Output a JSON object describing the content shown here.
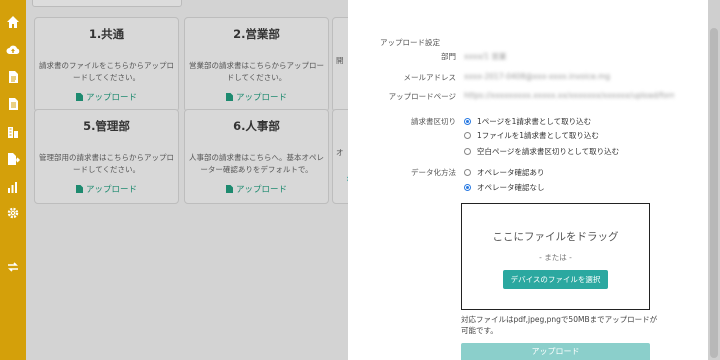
{
  "sidebar": {
    "icons": [
      "home-icon",
      "cloud-upload-icon",
      "document-icon",
      "document-list-icon",
      "building-icon",
      "document-export-icon",
      "chart-icon",
      "gear-icon",
      "transfer-icon"
    ]
  },
  "main": {
    "cards": [
      {
        "title": "1.共通",
        "desc": "請求書のファイルをこちらからアップロードしてください。",
        "upload": "アップロード"
      },
      {
        "title": "2.営業部",
        "desc": "営業部の請求書はこちらからアップロードしてください。",
        "upload": "アップロード"
      },
      {
        "title": "",
        "desc": "開",
        "upload": ""
      },
      {
        "title": "5.管理部",
        "desc": "管理部用の請求書はこちらからアップロードしてください。",
        "upload": "アップロード"
      },
      {
        "title": "6.人事部",
        "desc": "人事部の請求書はこちらへ。基本オペレーター確認ありをデフォルトで。",
        "upload": "アップロード"
      },
      {
        "title": "",
        "desc": "オ",
        "upload": ""
      }
    ],
    "toggle_arrow": "›"
  },
  "panel": {
    "section_title": "アップロード設定",
    "department_label": "部門",
    "department_value": "xxxx/1 営業",
    "mail_label": "メールアドレス",
    "mail_value": "xxxx-2017-0408@xxx-xxxx.invoice.mg",
    "page_label": "アップロードページ",
    "page_value": "https://xxxxxxxxx.xxxxx.xx/xxxxxxx/xxxxxx/upload/form/xxxx-1234",
    "split_label": "請求書区切り",
    "split_options": [
      {
        "label": "1ページを1請求書として取り込む",
        "selected": true
      },
      {
        "label": "1ファイルを1請求書として取り込む",
        "selected": false
      },
      {
        "label": "空白ページを請求書区切りとして取り込む",
        "selected": false
      }
    ],
    "method_label": "データ化方法",
    "method_options": [
      {
        "label": "オペレータ確認あり",
        "selected": false
      },
      {
        "label": "オペレータ確認なし",
        "selected": true
      }
    ],
    "drop_title": "ここにファイルをドラッグ",
    "drop_or": "- または -",
    "select_button": "デバイスのファイルを選択",
    "support_note": "対応ファイルはpdf,jpeg,pngで50MBまでアップロードが可能です。",
    "upload_button": "アップロード"
  },
  "colors": {
    "sidebar": "#d4a00a",
    "accent": "#2ba8a0",
    "upload_disabled": "#8bcfcb",
    "radio_selected": "#2a7ae2"
  }
}
